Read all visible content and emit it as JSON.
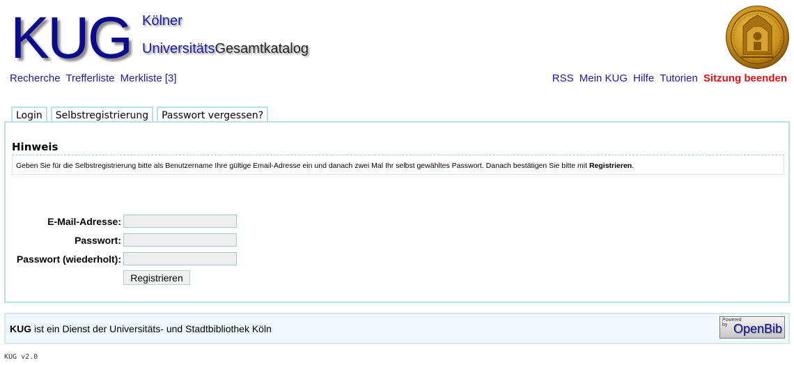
{
  "header": {
    "logo_text": "KUG",
    "subtitle_line1": "Kölner",
    "subtitle_line2_a": "Universitäts",
    "subtitle_line2_b": "Gesamtkatalog",
    "seal_icon": "university-seal-icon"
  },
  "nav_left": {
    "items": [
      "Recherche",
      "Trefferliste",
      "Merkliste [3]"
    ]
  },
  "nav_right": {
    "items": [
      "RSS",
      "Mein KUG",
      "Hilfe",
      "Tutorien"
    ],
    "logout": "Sitzung beenden",
    "logout_color": "#e01010"
  },
  "tabs": [
    "Login",
    "Selbstregistrierung",
    "Passwort vergessen?"
  ],
  "notice": {
    "title": "Hinweis",
    "text": "Geben Sie für die Selbstregistrierung bitte als Benutzername Ihre gültige Email-Adresse ein und danach zwei Mal Ihr selbst gewähltes Passwort. Danach bestätigen Sie bitte mit ",
    "text_bold": "Registrieren",
    "text_end": "."
  },
  "form": {
    "email_label": "E-Mail-Adresse:",
    "password_label": "Passwort:",
    "password_repeat_label": "Passwort (wiederholt):",
    "email_value": "",
    "password_value": "",
    "password_repeat_value": "",
    "submit_label": "Registrieren"
  },
  "footer": {
    "brand": "KUG",
    "text": " ist ein Dienst der Universitäts- und Stadtbibliothek Köln",
    "powered_small_1": "Powered",
    "powered_small_2": "by",
    "powered_name": "OpenBib"
  },
  "version": "KUG v2.0",
  "colors": {
    "link": "#1a1a9e",
    "logo": "#0b0b8c",
    "border": "#b8dfe6"
  }
}
